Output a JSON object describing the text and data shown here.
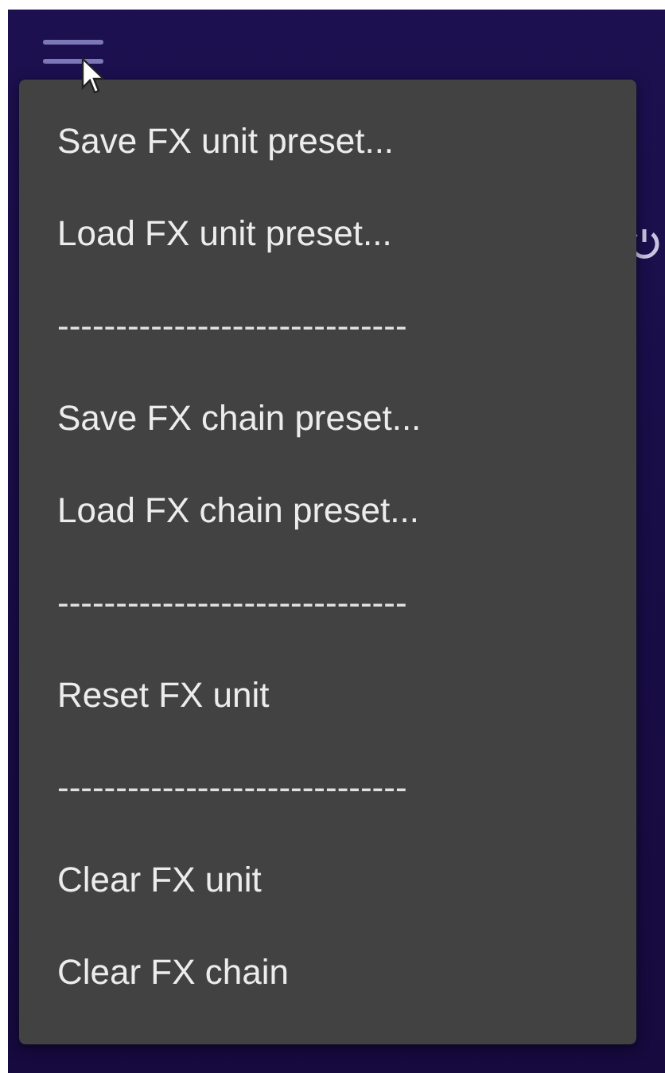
{
  "menu": {
    "items": [
      {
        "kind": "action",
        "label": "Save FX unit preset..."
      },
      {
        "kind": "action",
        "label": "Load FX unit preset..."
      },
      {
        "kind": "separator",
        "label": "------------------------------"
      },
      {
        "kind": "action",
        "label": "Save FX chain preset..."
      },
      {
        "kind": "action",
        "label": "Load FX chain preset..."
      },
      {
        "kind": "separator",
        "label": "------------------------------"
      },
      {
        "kind": "action",
        "label": "Reset FX unit"
      },
      {
        "kind": "separator",
        "label": "------------------------------"
      },
      {
        "kind": "action",
        "label": "Clear FX unit"
      },
      {
        "kind": "action",
        "label": "Clear FX chain"
      }
    ]
  }
}
